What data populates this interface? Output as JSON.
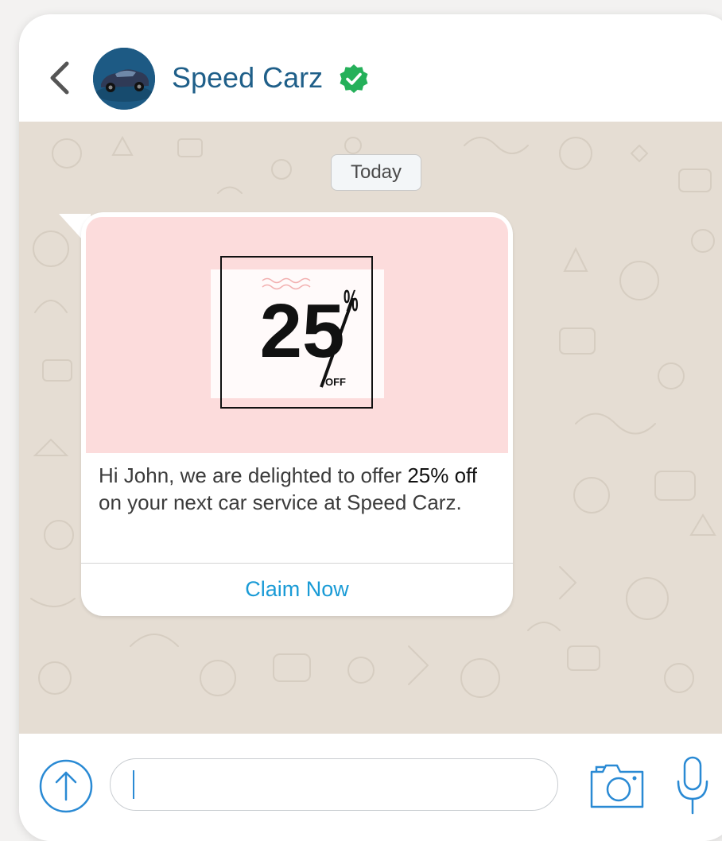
{
  "header": {
    "contact_name": "Speed Carz",
    "verified": true,
    "icons": {
      "back": "chevron-left-icon",
      "verified": "verified-check-icon",
      "avatar": "car-avatar"
    }
  },
  "chat": {
    "date_label": "Today",
    "message": {
      "image": {
        "discount_number": "25",
        "percent_sign": "%",
        "off_label": "OFF"
      },
      "text_before": "Hi John, we are delighted to offer ",
      "highlight": "25% off",
      "text_after": " on your next car service at Speed Carz.",
      "action_label": "Claim Now"
    }
  },
  "composer": {
    "input_value": "",
    "icons": {
      "upload": "arrow-up-circle-icon",
      "camera": "camera-icon",
      "mic": "microphone-icon"
    }
  },
  "colors": {
    "accent": "#1a9bd6",
    "name": "#1f5f89",
    "verified": "#25b05a",
    "chat_bg": "#e5ddd3",
    "promo_bg": "#fcdcdc"
  }
}
